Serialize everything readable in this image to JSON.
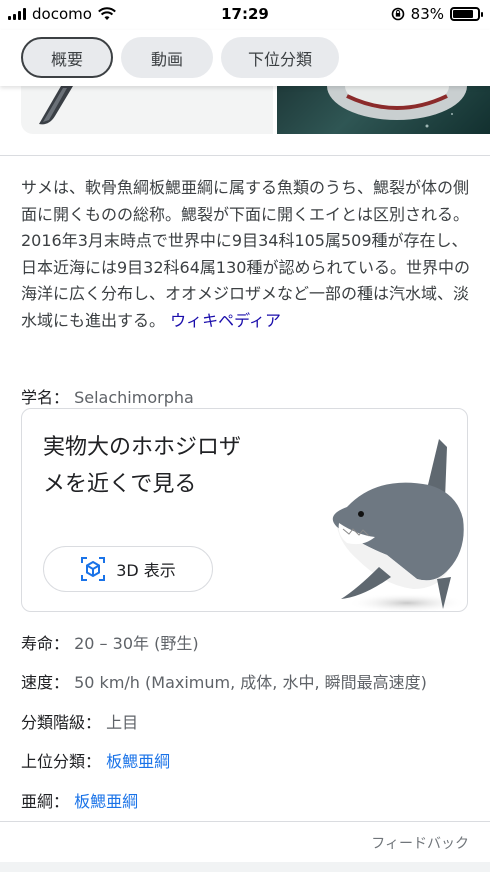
{
  "status": {
    "carrier": "docomo",
    "time": "17:29",
    "battery": "83%",
    "battery_level": 0.83
  },
  "tabs": [
    {
      "label": "概要",
      "active": true
    },
    {
      "label": "動画",
      "active": false
    },
    {
      "label": "下位分類",
      "active": false
    }
  ],
  "description": {
    "text": "サメは、軟骨魚綱板鰓亜綱に属する魚類のうち、鰓裂が体の側面に開くものの総称。鰓裂が下面に開くエイとは区別される。2016年3月末時点で世界中に9目34科105属509種が存在し、日本近海には9目32科64属130種が認められている。世界中の海洋に広く分布し、オオメジロザメなど一部の種は汽水域、淡水域にも進出する。",
    "source": "ウィキペディア"
  },
  "facts": {
    "scientific_name": {
      "key": "学名：",
      "value": "Selachimorpha"
    },
    "lifespan": {
      "key": "寿命：",
      "value": "20 – 30年 (野生)"
    },
    "speed": {
      "key": "速度：",
      "value": "50 km/h (Maximum, 成体, 水中, 瞬間最高速度)"
    },
    "rank": {
      "key": "分類階級：",
      "value": "上目"
    },
    "parent": {
      "key": "上位分類：",
      "value": "板鰓亜綱"
    },
    "subclass": {
      "key": "亜綱：",
      "value": "板鰓亜綱"
    }
  },
  "card": {
    "title": "実物大のホホジロザメを近くで見る",
    "button": "3D 表示"
  },
  "feedback": "フィードバック"
}
